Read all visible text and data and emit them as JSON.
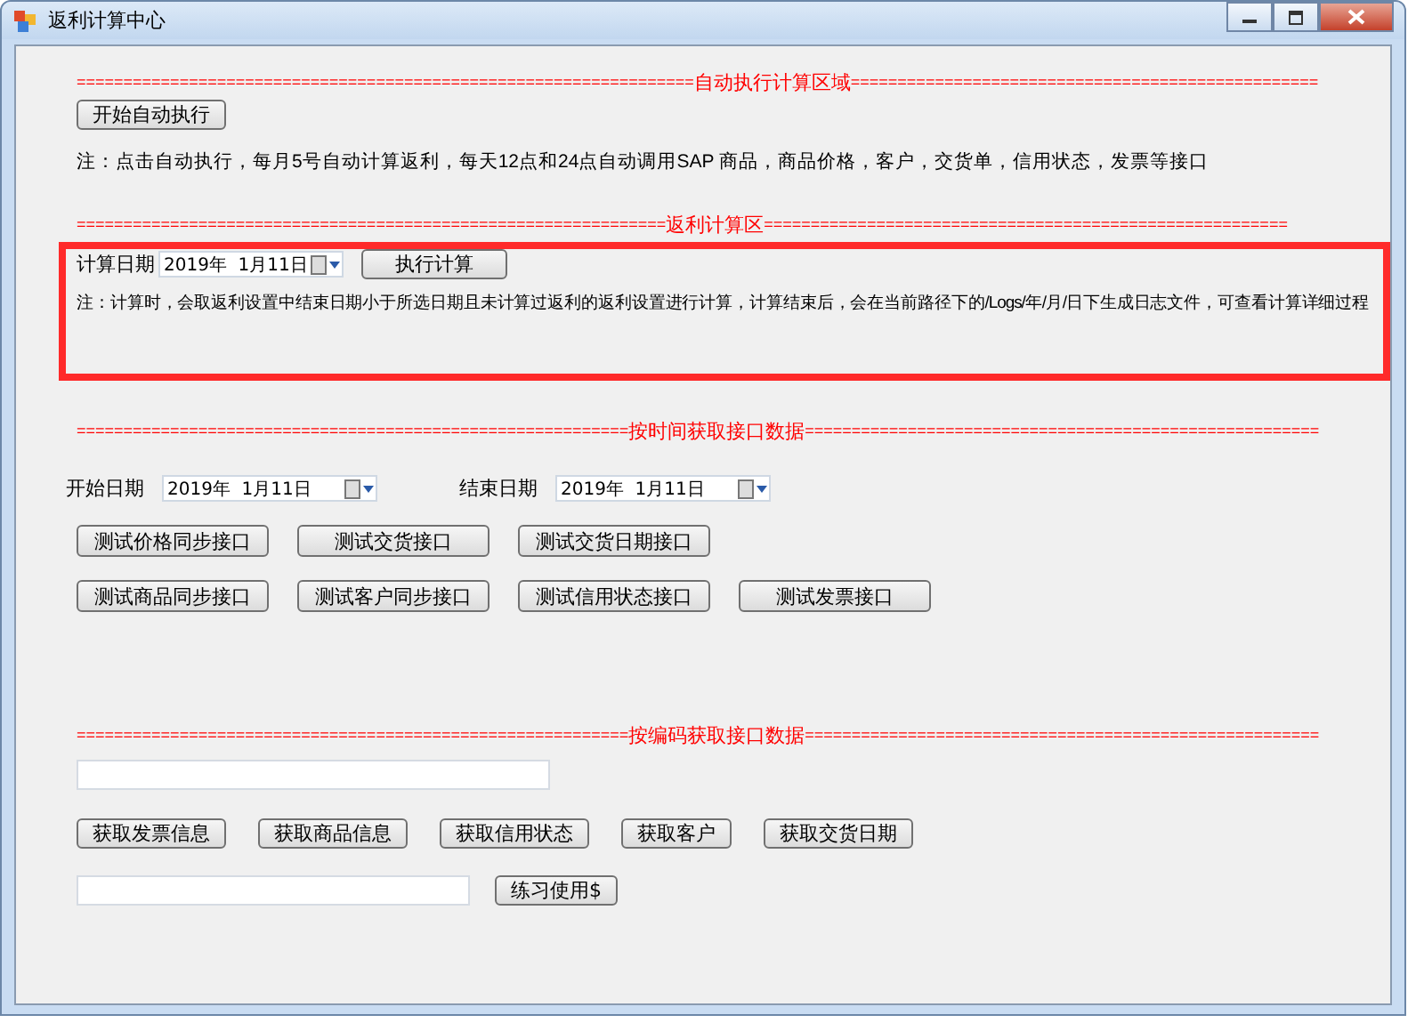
{
  "window": {
    "title": "返利计算中心"
  },
  "auto_section": {
    "header_left": "==================================================================",
    "header_title": "自动执行计算区域",
    "header_right": "==================================================",
    "button": "开始自动执行",
    "note": "注：点击自动执行，每月5号自动计算返利，每天12点和24点自动调用SAP 商品，商品价格，客户，交货单，信用状态，发票等接口"
  },
  "calc_section": {
    "header_left": "===============================================================",
    "header_title": "返利计算区",
    "header_right": "========================================================",
    "date_label": "计算日期",
    "date_value": "2019年  1月11日",
    "button": "执行计算",
    "note": "注：计算时，会取返利设置中结束日期小于所选日期且未计算过返利的返利设置进行计算，计算结束后，会在当前路径下的/Logs/年/月/日下生成日志文件，可查看计算详细过程"
  },
  "time_section": {
    "header_left": "===========================================================",
    "header_title": "按时间获取接口数据",
    "header_right": "=======================================================",
    "start_label": "开始日期",
    "start_value": "2019年  1月11日",
    "end_label": "结束日期",
    "end_value": "2019年  1月11日",
    "button_rows": [
      [
        "测试价格同步接口",
        "测试交货接口",
        "测试交货日期接口"
      ],
      [
        "测试商品同步接口",
        "测试客户同步接口",
        "测试信用状态接口",
        "测试发票接口"
      ]
    ]
  },
  "code_section": {
    "header_left": "===========================================================",
    "header_title": "按编码获取接口数据",
    "header_right": "=======================================================",
    "buttons": [
      "获取发票信息",
      "获取商品信息",
      "获取信用状态",
      "获取客户",
      "获取交货日期"
    ],
    "practice_button": "练习使用$"
  }
}
